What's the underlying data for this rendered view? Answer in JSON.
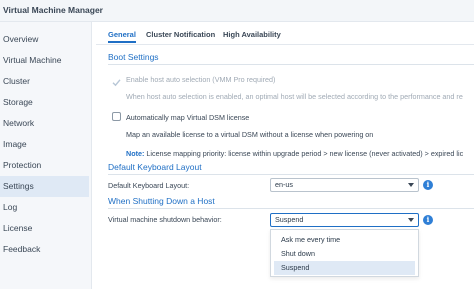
{
  "app": {
    "title": "Virtual Machine Manager"
  },
  "sidebar": {
    "items": [
      {
        "label": "Overview"
      },
      {
        "label": "Virtual Machine"
      },
      {
        "label": "Cluster"
      },
      {
        "label": "Storage"
      },
      {
        "label": "Network"
      },
      {
        "label": "Image"
      },
      {
        "label": "Protection"
      },
      {
        "label": "Settings",
        "active": true
      },
      {
        "label": "Log"
      },
      {
        "label": "License"
      },
      {
        "label": "Feedback"
      }
    ]
  },
  "tabs": [
    {
      "label": "General",
      "active": true
    },
    {
      "label": "Cluster Notification"
    },
    {
      "label": "High Availability"
    }
  ],
  "boot": {
    "title": "Boot Settings",
    "auto_select": {
      "label": "Enable host auto selection (VMM Pro required)",
      "checked": true,
      "disabled": true,
      "description": "When host auto selection is enabled, an optimal host will be selected according to the performance and re"
    },
    "auto_map": {
      "label": "Automatically map Virtual DSM license",
      "checked": false,
      "description": "Map an available license to a virtual DSM without a license when powering on",
      "note_key": "Note:",
      "note_text": "License mapping priority: license within upgrade period > new license (never activated) > expired lic"
    }
  },
  "keyboard": {
    "title": "Default Keyboard Layout",
    "label": "Default Keyboard Layout:",
    "value": "en-us",
    "info_icon": "i"
  },
  "shutdown": {
    "title": "When Shutting Down a Host",
    "label": "Virtual machine shutdown behavior:",
    "value": "Suspend",
    "info_icon": "i",
    "options": [
      "Ask me every time",
      "Shut down",
      "Suspend"
    ],
    "selected": "Suspend"
  },
  "colors": {
    "accent": "#1f6fc5",
    "info": "#2f7fd6",
    "selected_bg": "#dfe9f5",
    "muted_text": "#a0aab5",
    "sidebar_bg": "#f5f7fa"
  }
}
